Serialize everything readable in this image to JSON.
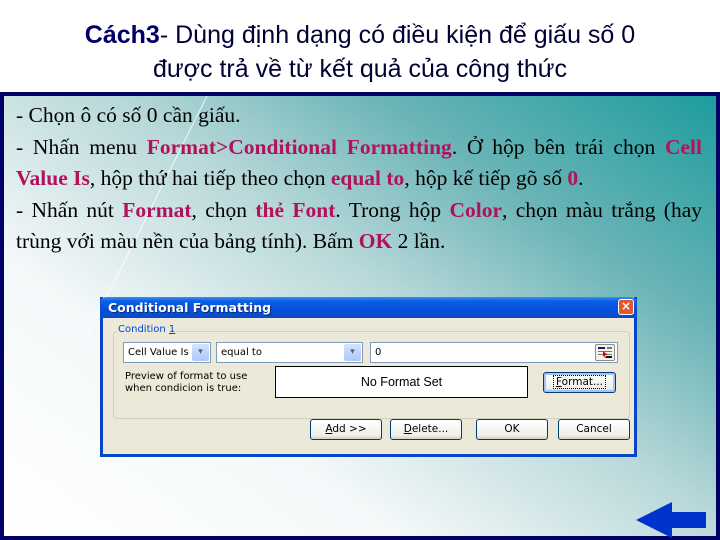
{
  "slide": {
    "title_bold": "Cách3",
    "title_rest": "- Dùng định dạng có điều kiện để giấu số 0",
    "title_line2": "được trả về từ kết quả của công thức"
  },
  "body": {
    "line1": "- Chọn ô có số 0 cần giấu.",
    "p2_a": "- Nhấn menu ",
    "p2_hl1": "Format>Conditional Formatting",
    "p2_b": ". Ở hộp bên trái chọn ",
    "p2_hl2": "Cell Value Is",
    "p2_c": ", hộp thứ hai tiếp theo chọn ",
    "p2_hl3": "equal to",
    "p2_d": ", hộp kế tiếp gõ số ",
    "p2_hl4": "0",
    "p2_e": ".",
    "p3_a": "- Nhấn nút ",
    "p3_hl1": "Format",
    "p3_b": ", chọn ",
    "p3_hl2": "thẻ Font",
    "p3_c": ". Trong hộp ",
    "p3_hl3": "Color",
    "p3_d": ", chọn màu trắng (hay trùng với màu nền của bảng tính). Bấm ",
    "p3_hl4": "OK",
    "p3_e": " 2 lần."
  },
  "dialog": {
    "title": "Conditional Formatting",
    "close_icon": "×",
    "group_label": "Condition ",
    "group_number": "1",
    "condition_type": "Cell Value Is",
    "operator": "equal to",
    "value": "0",
    "dropdown_icon": "▾",
    "preview_label_line1": "Preview of format to use",
    "preview_label_line2": "when condicion is true:",
    "preview_text": "No Format Set",
    "buttons": {
      "format_u": "F",
      "format_rest": "ormat...",
      "add_u": "A",
      "add_rest": "dd >>",
      "delete_u": "D",
      "delete_rest": "elete...",
      "ok": "OK",
      "cancel": "Cancel"
    }
  },
  "colors": {
    "highlight": "#b0125b",
    "panel_border": "#000066",
    "title_bar": "#0a5ee6",
    "nav_arrow": "#0033cc"
  },
  "navigation": {
    "back_icon": "left-arrow"
  }
}
